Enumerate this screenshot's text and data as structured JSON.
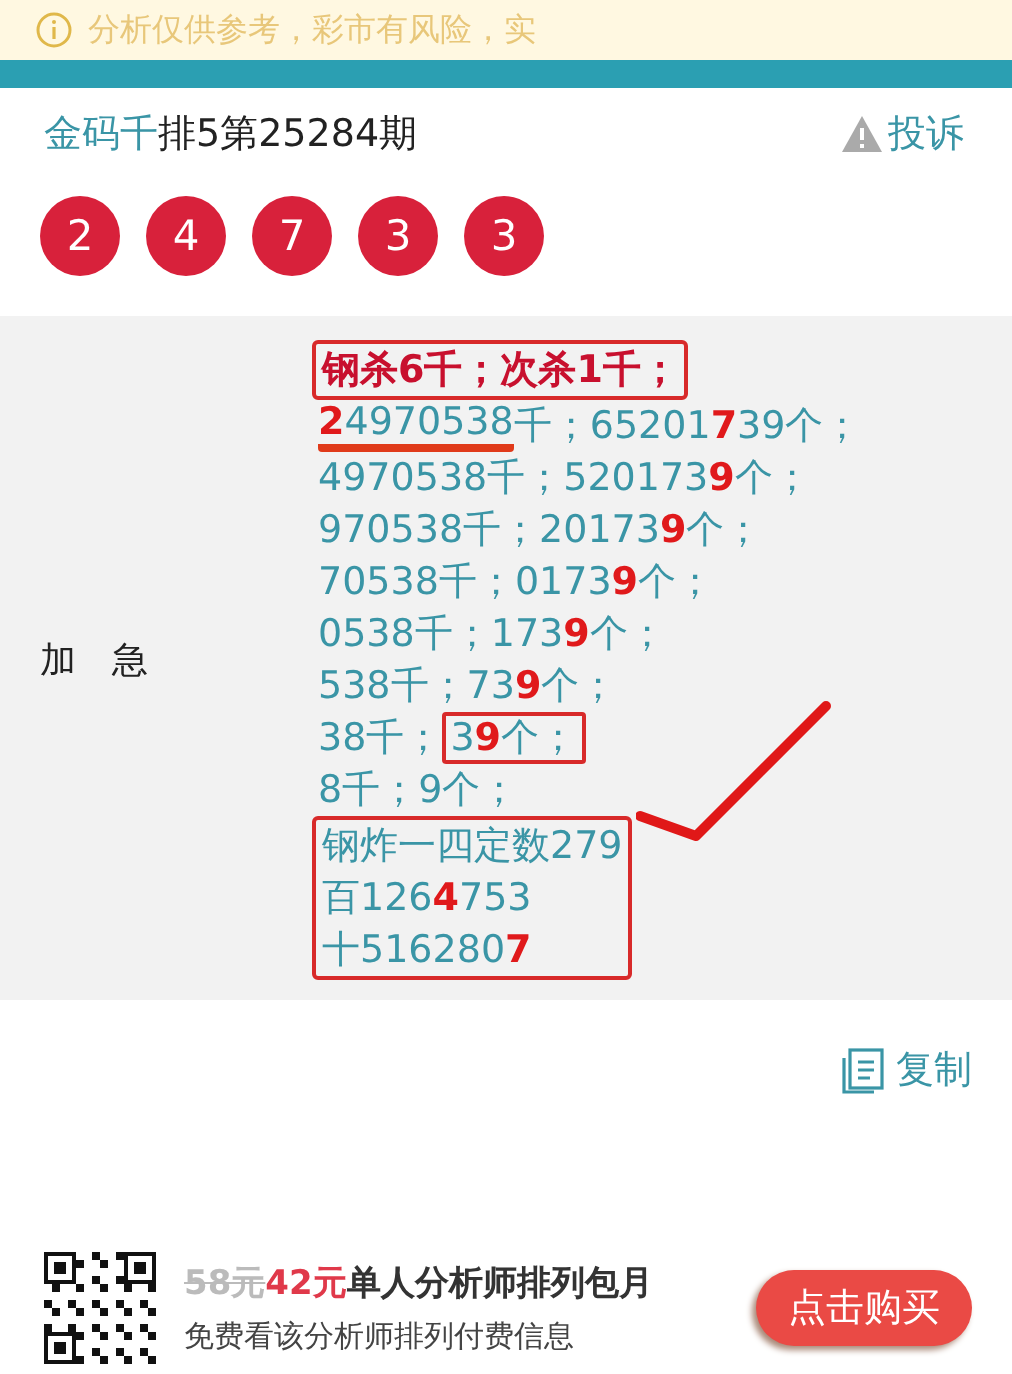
{
  "notice": {
    "text": "分析仅供参考，彩市有风险，实"
  },
  "header": {
    "expert": "金码千",
    "title": "排5第25284期",
    "report": "投诉"
  },
  "balls": [
    "2",
    "4",
    "7",
    "3",
    "3"
  ],
  "content": {
    "label": "加　急",
    "check_mark": true,
    "blocks": [
      {
        "kind": "framed",
        "lines": [
          {
            "kind": "heading",
            "segments": [
              {
                "kind": "plain",
                "text": "钢杀6千；次杀1千；"
              }
            ]
          }
        ]
      },
      {
        "kind": "plain",
        "lines": [
          {
            "kind": "normal",
            "segments": [
              {
                "kind": "underlined",
                "text": "**2**4970538"
              },
              {
                "kind": "plain",
                "text": "千；65201**7**39个；"
              }
            ]
          },
          {
            "kind": "normal",
            "segments": [
              {
                "kind": "plain",
                "text": "4970538千；520173**9**个；"
              }
            ]
          },
          {
            "kind": "normal",
            "segments": [
              {
                "kind": "plain",
                "text": "970538千；20173**9**个；"
              }
            ]
          },
          {
            "kind": "normal",
            "segments": [
              {
                "kind": "plain",
                "text": "70538千；0173**9**个；"
              }
            ]
          },
          {
            "kind": "normal",
            "segments": [
              {
                "kind": "plain",
                "text": "0538千；173**9**个；"
              }
            ]
          },
          {
            "kind": "normal",
            "segments": [
              {
                "kind": "plain",
                "text": "538千；73**9**个；"
              }
            ]
          },
          {
            "kind": "normal",
            "segments": [
              {
                "kind": "plain",
                "text": "38千；"
              },
              {
                "kind": "framed",
                "text": "3**9**个；"
              }
            ]
          },
          {
            "kind": "normal",
            "segments": [
              {
                "kind": "plain",
                "text": "8千；9个；"
              }
            ]
          }
        ]
      },
      {
        "kind": "framed",
        "lines": [
          {
            "kind": "normal",
            "segments": [
              {
                "kind": "plain",
                "text": "钢炸一四定数279"
              }
            ]
          },
          {
            "kind": "normal",
            "segments": [
              {
                "kind": "plain",
                "text": "百126**4**753"
              }
            ]
          },
          {
            "kind": "normal",
            "segments": [
              {
                "kind": "plain",
                "text": "十516280**7**"
              }
            ]
          }
        ]
      }
    ]
  },
  "copy": {
    "label": "复制"
  },
  "promo": {
    "old_price": "58元",
    "price": "42元",
    "title": "单人分析师排列包月",
    "subtitle": "免费看该分析师排列付费信息",
    "button": "点击购买"
  }
}
